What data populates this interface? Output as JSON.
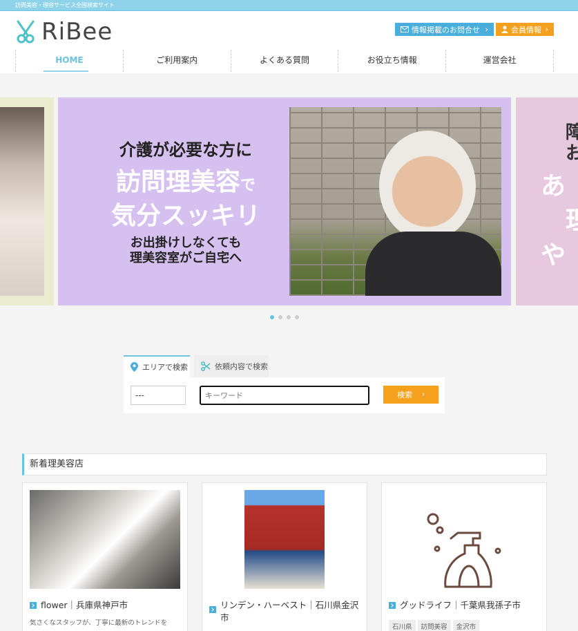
{
  "top_strip": {
    "text": "訪問美容・理容サービス全国検索サイト"
  },
  "brand": {
    "name": "RiBee",
    "accent": "#6cc3e0",
    "orange": "#f5a11d"
  },
  "header_buttons": {
    "info": {
      "label": "情報掲載のお問合せ",
      "icon": "mail-icon"
    },
    "member": {
      "label": "会員情報",
      "icon": "person-icon"
    }
  },
  "nav": {
    "items": [
      {
        "label": "HOME"
      },
      {
        "label": "ご利用案内"
      },
      {
        "label": "よくある質問"
      },
      {
        "label": "お役立ち情報"
      },
      {
        "label": "運営会社"
      }
    ]
  },
  "slider": {
    "main": {
      "line1": "介護が必要な方に",
      "line2a": "訪問理美容",
      "line2b": "で",
      "line3": "気分スッキリ",
      "line4": "お出掛けしなくても",
      "line5": "理美容室がご自宅へ"
    },
    "right": {
      "line1": "障",
      "line2": "お",
      "line3": "あ",
      "line4": "理",
      "line5": "や"
    }
  },
  "search": {
    "tab_area": "エリアで検索",
    "tab_request": "依頼内容で検索",
    "select_value": "---",
    "keyword_placeholder": "キーワード",
    "button": "検索"
  },
  "new_shops": {
    "title": "新着理美容店",
    "cards": [
      {
        "title": "flower｜兵庫県神戸市",
        "desc": "気さくなスタッフが、丁寧に最新のトレンドを"
      },
      {
        "title": "リンデン・ハーベスト｜石川県金沢市"
      },
      {
        "title": "グッドライフ｜千葉県我孫子市",
        "tags": [
          "石川県",
          "訪問美容",
          "金沢市"
        ]
      }
    ]
  }
}
